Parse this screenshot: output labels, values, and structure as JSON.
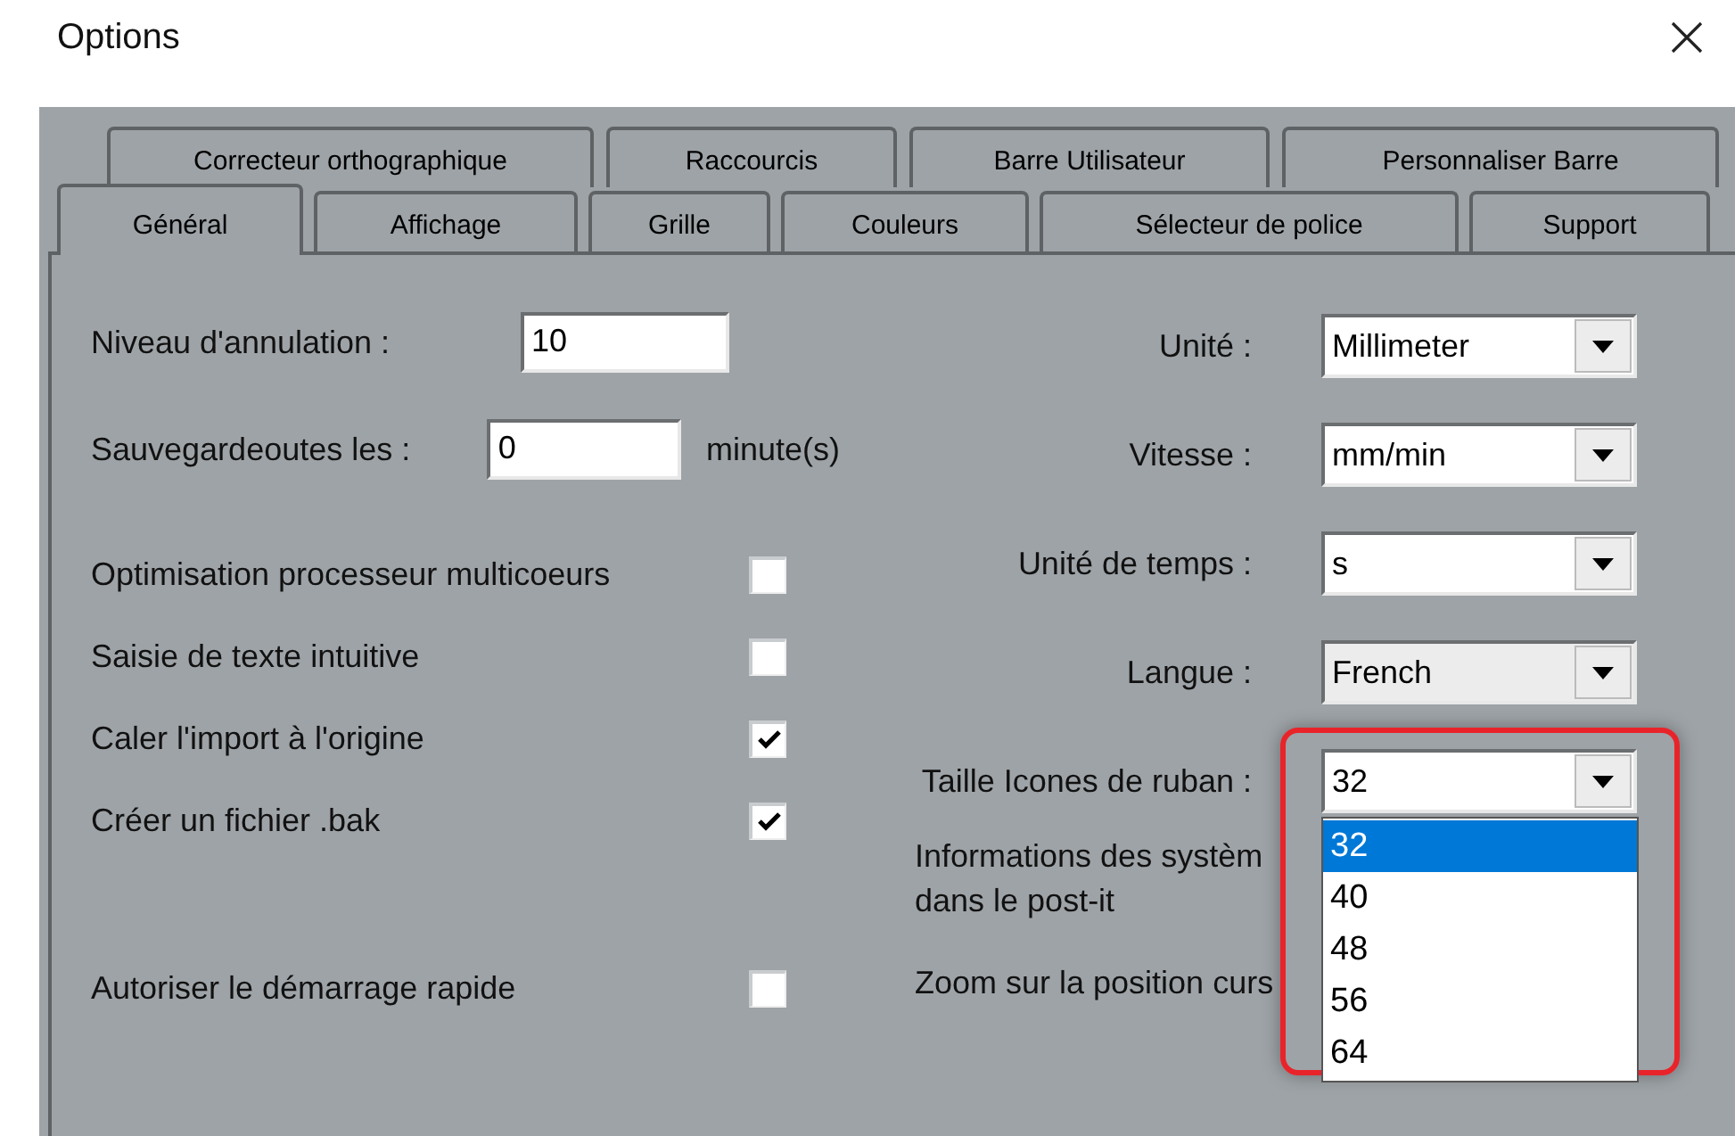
{
  "window": {
    "title": "Options"
  },
  "tab_rows": [
    [
      {
        "label": "Correcteur orthographique",
        "selected": false
      },
      {
        "label": "Raccourcis",
        "selected": false
      },
      {
        "label": "Barre Utilisateur",
        "selected": false
      },
      {
        "label": "Personnaliser Barre",
        "selected": false
      }
    ],
    [
      {
        "label": "Général",
        "selected": true
      },
      {
        "label": "Affichage",
        "selected": false
      },
      {
        "label": "Grille",
        "selected": false
      },
      {
        "label": "Couleurs",
        "selected": false
      },
      {
        "label": "Sélecteur de police",
        "selected": false
      },
      {
        "label": "Support",
        "selected": false
      }
    ]
  ],
  "fields": [
    {
      "label": "Niveau d'annulation :",
      "value": "10"
    },
    {
      "label": "Sauvegardeoutes les :",
      "value": "0",
      "unit": "minute(s)"
    }
  ],
  "checkboxes": [
    {
      "label": "Optimisation processeur multicoeurs",
      "checked": false
    },
    {
      "label": "Saisie de texte intuitive",
      "checked": false
    },
    {
      "label": "Caler l'import à l'origine",
      "checked": true
    },
    {
      "label": "Créer un fichier .bak",
      "checked": true
    },
    {
      "label": "Autoriser le démarrage rapide",
      "checked": false
    }
  ],
  "combos": [
    {
      "label": "Unité :",
      "value": "Millimeter",
      "kind": "editable"
    },
    {
      "label": "Vitesse :",
      "value": "mm/min",
      "kind": "editable"
    },
    {
      "label": "Unité de temps :",
      "value": "s",
      "kind": "editable"
    },
    {
      "label": "Langue :",
      "value": "French",
      "kind": "readonly"
    },
    {
      "label": "Taille Icones de ruban :",
      "value": "32",
      "kind": "editable",
      "options": [
        {
          "label": "32",
          "selected": true
        },
        {
          "label": "40",
          "selected": false
        },
        {
          "label": "48",
          "selected": false
        },
        {
          "label": "56",
          "selected": false
        },
        {
          "label": "64",
          "selected": false
        }
      ]
    }
  ],
  "highlight_frame": true,
  "notes": [
    "Informations des systèm\ndans le post-it",
    "Zoom sur la position curs"
  ]
}
